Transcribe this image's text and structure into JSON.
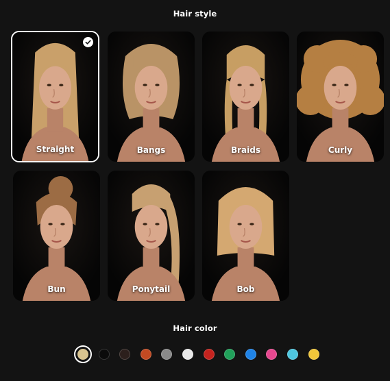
{
  "hair_style": {
    "title": "Hair style",
    "selected": "Straight",
    "options": [
      {
        "label": "Straight",
        "hair_color": "#c9a06a",
        "style": "straight"
      },
      {
        "label": "Bangs",
        "hair_color": "#b99366",
        "style": "bangs"
      },
      {
        "label": "Braids",
        "hair_color": "#c79e63",
        "style": "braids"
      },
      {
        "label": "Curly",
        "hair_color": "#b57f42",
        "style": "curly"
      },
      {
        "label": "Bun",
        "hair_color": "#9c6c44",
        "style": "bun"
      },
      {
        "label": "Ponytail",
        "hair_color": "#c7a071",
        "style": "ponytail"
      },
      {
        "label": "Bob",
        "hair_color": "#d4a871",
        "style": "bob"
      }
    ]
  },
  "hair_color": {
    "title": "Hair color",
    "selected_index": 0,
    "swatches": [
      {
        "name": "blonde",
        "color": "#d9c48f"
      },
      {
        "name": "black",
        "color": "#0b0b0b"
      },
      {
        "name": "dark-brown",
        "color": "#2c1f1c"
      },
      {
        "name": "auburn",
        "color": "#c24a22"
      },
      {
        "name": "gray",
        "color": "#8a8a8a"
      },
      {
        "name": "white",
        "color": "#e9e9e9"
      },
      {
        "name": "red",
        "color": "#c5231e"
      },
      {
        "name": "green",
        "color": "#21a05a"
      },
      {
        "name": "blue",
        "color": "#1f83e6"
      },
      {
        "name": "pink",
        "color": "#e6488f"
      },
      {
        "name": "cyan",
        "color": "#4ec6df"
      },
      {
        "name": "yellow",
        "color": "#f1c63a"
      }
    ]
  }
}
